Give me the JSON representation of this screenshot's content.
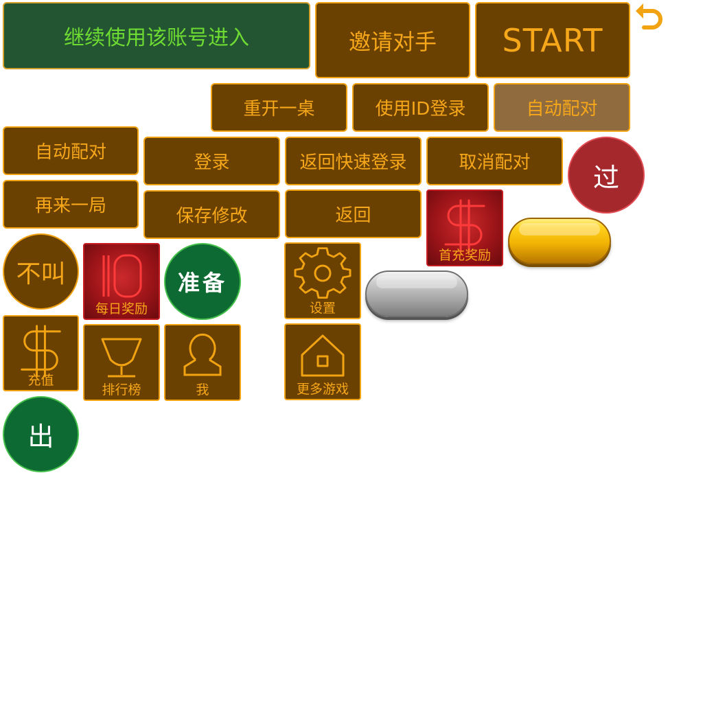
{
  "colors": {
    "brown_fill": "#6b4102",
    "orange_border": "#f2a312",
    "orange_text": "#f7a71a",
    "green_fill": "#235532",
    "green_text": "#6edb32",
    "red_circle": "#a4282c",
    "dark_green_circle": "#0e6a33",
    "muted_brown": "#8f6b3d"
  },
  "buttons": {
    "continue_account": "继续使用该账号进入",
    "invite_opponent": "邀请对手",
    "start": "START",
    "reopen_table": "重开一桌",
    "login_with_id": "使用ID登录",
    "auto_match_disabled": "自动配对",
    "auto_match": "自动配对",
    "login": "登录",
    "back_quick_login": "返回快速登录",
    "cancel_match": "取消配对",
    "pass": "过",
    "play_again": "再来一局",
    "save_changes": "保存修改",
    "back": "返回",
    "no_call": "不叫",
    "ready": "准备",
    "play_card": "出"
  },
  "tiles": {
    "first_recharge_reward": {
      "label": "首充奖励",
      "icon": "dollar-icon"
    },
    "daily_reward": {
      "label": "每日奖励",
      "icon": "calendar-ten-icon"
    },
    "settings": {
      "label": "设置",
      "icon": "gear-icon"
    },
    "recharge": {
      "label": "充值",
      "icon": "dollar-icon"
    },
    "leaderboard": {
      "label": "排行榜",
      "icon": "trophy-icon"
    },
    "me": {
      "label": "我",
      "icon": "user-icon"
    },
    "more_games": {
      "label": "更多游戏",
      "icon": "home-icon"
    }
  },
  "icons": {
    "back_arrow": "undo-arrow-icon",
    "yellow_pill": "yellow-pill-button",
    "gray_pill": "gray-pill-button"
  }
}
